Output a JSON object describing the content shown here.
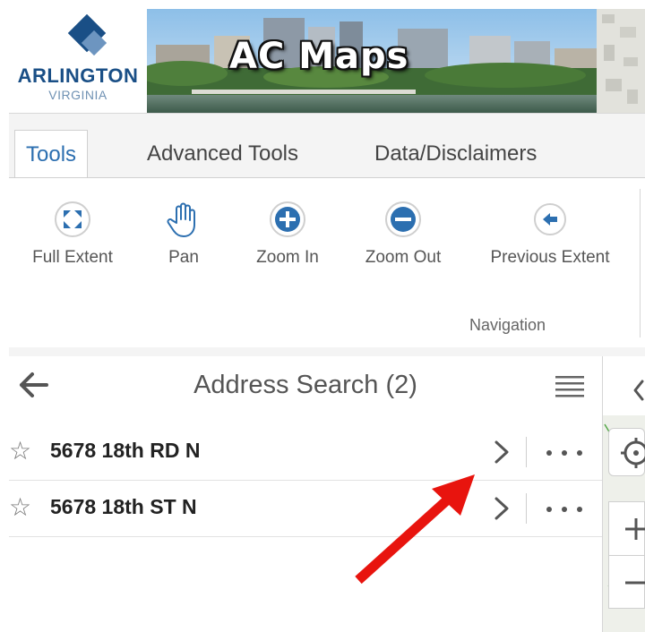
{
  "logo": {
    "name": "ARLINGTON",
    "sub": "VIRGINIA"
  },
  "app": {
    "title": "AC Maps"
  },
  "tabs": [
    {
      "label": "Tools",
      "active": true
    },
    {
      "label": "Advanced Tools",
      "active": false
    },
    {
      "label": "Data/Disclaimers",
      "active": false
    }
  ],
  "tools": [
    {
      "label": "Full Extent",
      "icon": "full-extent-icon"
    },
    {
      "label": "Pan",
      "icon": "hand-icon"
    },
    {
      "label": "Zoom In",
      "icon": "plus-circle-icon"
    },
    {
      "label": "Zoom Out",
      "icon": "minus-circle-icon"
    },
    {
      "label": "Previous Extent",
      "icon": "back-arrow-circle-icon"
    }
  ],
  "ribbon_group": "Navigation",
  "panel": {
    "title": "Address Search (2)",
    "results": [
      {
        "address": "5678 18th RD N"
      },
      {
        "address": "5678 18th ST N"
      }
    ]
  },
  "colors": {
    "accent": "#2c6fb0",
    "annotation": "#e8140e",
    "logo": "#1a4f86"
  }
}
